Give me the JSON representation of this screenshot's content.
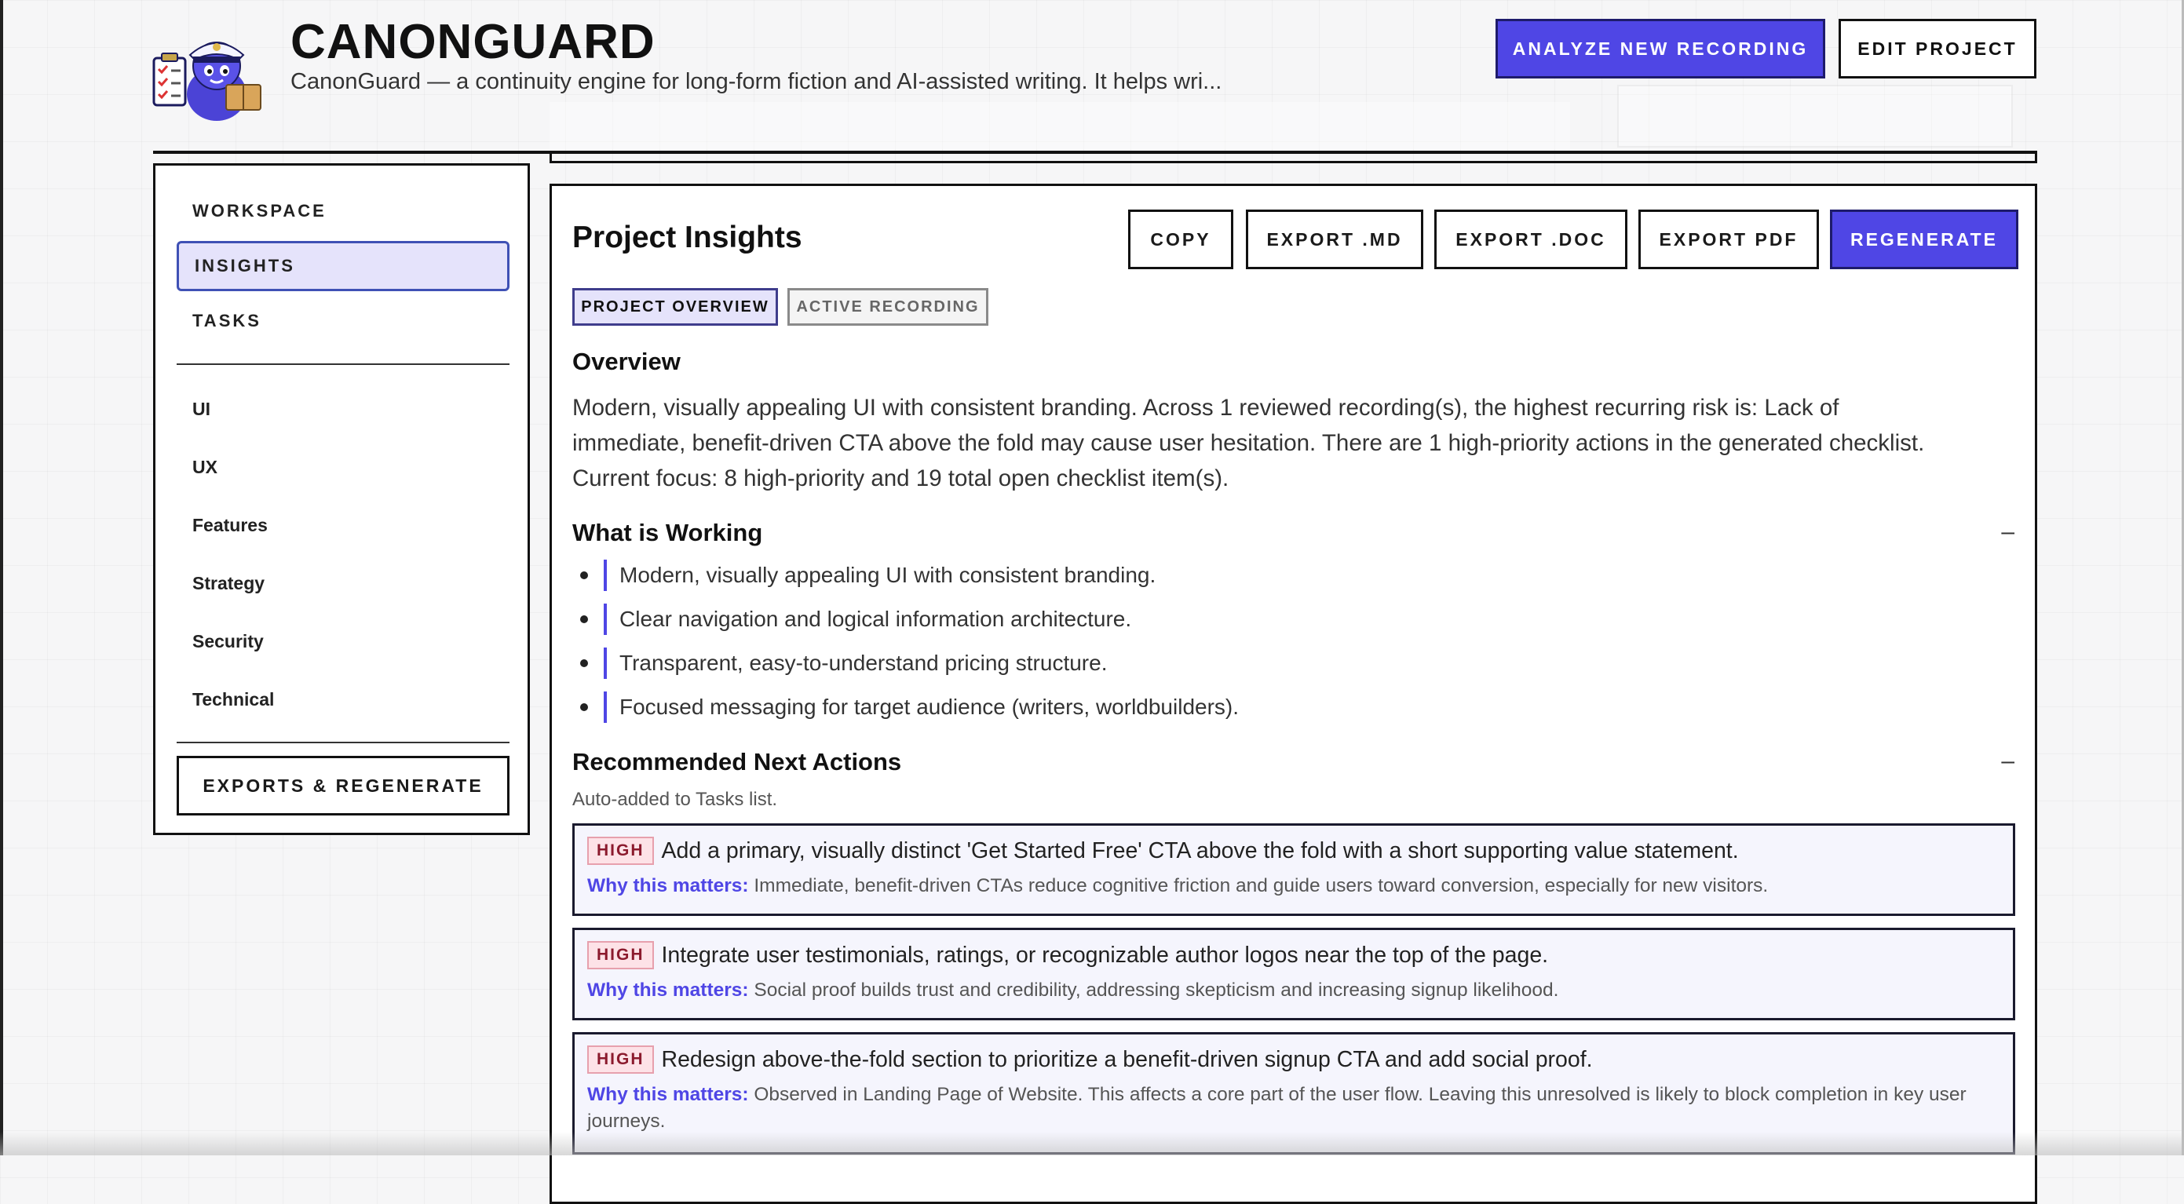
{
  "header": {
    "title": "CANONGUARD",
    "subtitle": "CanonGuard — a continuity engine for long-form fiction and AI-assisted writing. It helps wri...",
    "analyze_label": "ANALYZE NEW RECORDING",
    "edit_label": "EDIT PROJECT",
    "logo_icon": "captain-robot-mascot"
  },
  "sidebar": {
    "items": [
      {
        "label": "WORKSPACE"
      },
      {
        "label": "INSIGHTS"
      },
      {
        "label": "TASKS"
      },
      {
        "label": "UI"
      },
      {
        "label": "UX"
      },
      {
        "label": "Features"
      },
      {
        "label": "Strategy"
      },
      {
        "label": "Security"
      },
      {
        "label": "Technical"
      }
    ],
    "active": "INSIGHTS",
    "export_label": "EXPORTS & REGENERATE"
  },
  "panel": {
    "title": "Project Insights",
    "buttons": {
      "copy": "COPY",
      "export_md": "EXPORT .MD",
      "export_doc": "EXPORT .DOC",
      "export_pdf": "EXPORT PDF",
      "regenerate": "REGENERATE"
    },
    "tabs": {
      "overview": "PROJECT OVERVIEW",
      "recording": "ACTIVE RECORDING"
    },
    "overview_heading": "Overview",
    "overview_text": "Modern, visually appealing UI with consistent branding. Across 1 reviewed recording(s), the highest recurring risk is: Lack of immediate, benefit-driven CTA above the fold may cause user hesitation. There are 1 high-priority actions in the generated checklist. Current focus: 8 high-priority and 19 total open checklist item(s).",
    "working_heading": "What is Working",
    "collapse_symbol": "–",
    "working": [
      "Modern, visually appealing UI with consistent branding.",
      "Clear navigation and logical information architecture.",
      "Transparent, easy-to-understand pricing structure.",
      "Focused messaging for target audience (writers, worldbuilders)."
    ],
    "actions_heading": "Recommended Next Actions",
    "actions_note": "Auto-added to Tasks list.",
    "why_label": "Why this matters:",
    "actions": [
      {
        "priority": "HIGH",
        "text": "Add a primary, visually distinct 'Get Started Free' CTA above the fold with a short supporting value statement.",
        "why": "Immediate, benefit-driven CTAs reduce cognitive friction and guide users toward conversion, especially for new visitors."
      },
      {
        "priority": "HIGH",
        "text": "Integrate user testimonials, ratings, or recognizable author logos near the top of the page.",
        "why": "Social proof builds trust and credibility, addressing skepticism and increasing signup likelihood."
      },
      {
        "priority": "HIGH",
        "text": "Redesign above-the-fold section to prioritize a benefit-driven signup CTA and add social proof.",
        "why": "Observed in Landing Page of Website. This affects a core part of the user flow. Leaving this unresolved is likely to block completion in key user journeys."
      }
    ]
  },
  "colors": {
    "accent": "#4f46e5",
    "active_bg": "#e5e3fb",
    "badge_bg": "#fde2e7",
    "badge_text": "#8b1a2d"
  }
}
